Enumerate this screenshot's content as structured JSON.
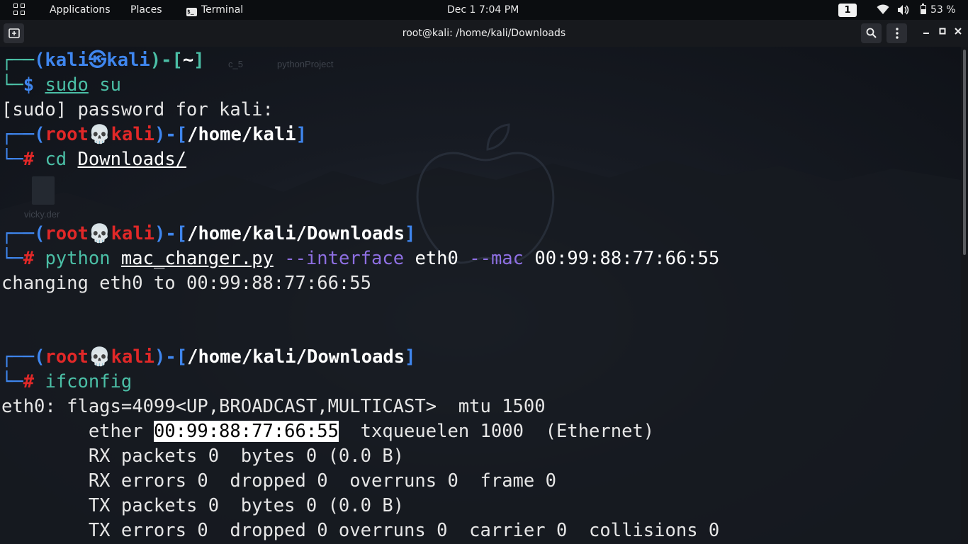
{
  "topbar": {
    "applications": "Applications",
    "places": "Places",
    "terminal": "Terminal",
    "terminal_icon_glyph": "$_",
    "clock": "Dec 1   7:04 PM",
    "workspace": "1",
    "battery": "53 %",
    "battery_level": 0.53,
    "icons": [
      "activities-grid-icon",
      "terminal-app-icon",
      "wifi-icon",
      "volume-icon",
      "battery-icon"
    ]
  },
  "window": {
    "title": "root@kali: /home/kali/Downloads",
    "icons": [
      "new-tab-icon",
      "search-icon",
      "menu-icon",
      "minimize-icon",
      "maximize-icon",
      "close-icon"
    ]
  },
  "desktop_ghosts": {
    "item1": "c_5",
    "item2": "pythonProject",
    "item3": "vicky.der"
  },
  "prompt": {
    "corner_top": "┌──",
    "corner_bottom": "└─",
    "open": "(",
    "close": ")-[",
    "end": "]",
    "user_kali": "kali",
    "host_kali": "kali",
    "user_root": "root",
    "host": "kali",
    "sep_kali": "㉿",
    "sep_root": "💀",
    "dollar": "$",
    "hash": "#"
  },
  "session": {
    "p1_dir": "~",
    "cmd1_a": "sudo",
    "cmd1_b": " su",
    "sudo_prompt": "[sudo] password for kali:",
    "p2_dir": "/home/kali",
    "cmd2_a": "cd",
    "cmd2_b": "Downloads/",
    "p3_dir": "/home/kali/Downloads",
    "cmd3_python": "python",
    "cmd3_script": "mac_changer.py",
    "cmd3_opt1": "--interface",
    "cmd3_iface": "eth0",
    "cmd3_opt2": "--mac",
    "cmd3_mac": "00:99:88:77:66:55",
    "output_changing": "changing eth0 to 00:99:88:77:66:55",
    "p4_dir": "/home/kali/Downloads",
    "cmd4": "ifconfig",
    "if_line1": "eth0: flags=4099<UP,BROADCAST,MULTICAST>  mtu 1500",
    "if_ether_pre": "        ether ",
    "if_ether_mac": "00:99:88:77:66:55",
    "if_ether_post": "  txqueuelen 1000  (Ethernet)",
    "if_rx_packets": "        RX packets 0  bytes 0 (0.0 B)",
    "if_rx_errors": "        RX errors 0  dropped 0  overruns 0  frame 0",
    "if_tx_packets": "        TX packets 0  bytes 0 (0.0 B)",
    "if_tx_errors": "        TX errors 0  dropped 0 overruns 0  carrier 0  collisions 0"
  },
  "colors": {
    "prompt_frame": "#3f86ee",
    "command": "#4bbfa6",
    "root_user": "#e12828",
    "option": "#8e6fe2",
    "selection_bg": "#ffffff"
  }
}
